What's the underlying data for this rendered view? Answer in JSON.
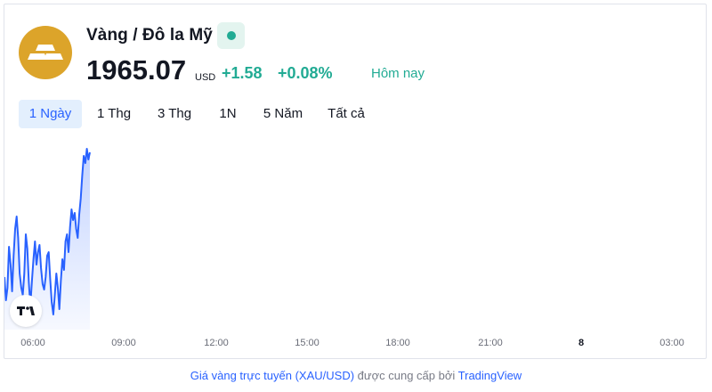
{
  "instrument": {
    "title": "Vàng / Đô la Mỹ",
    "logo_icon": "gold-bars-icon",
    "status_icon": "market-open-dot-icon",
    "status_color": "#22ab94"
  },
  "quote": {
    "price": "1965.07",
    "currency": "USD",
    "change": "+1.58",
    "change_pct": "+0.08%",
    "period": "Hôm nay",
    "positive_color": "#22ab94"
  },
  "tabs": [
    {
      "label": "1 Ngày",
      "active": true
    },
    {
      "label": "1 Thg",
      "active": false
    },
    {
      "label": "3 Thg",
      "active": false
    },
    {
      "label": "1N",
      "active": false
    },
    {
      "label": "5 Năm",
      "active": false
    },
    {
      "label": "Tất cả",
      "active": false
    }
  ],
  "chart_data": {
    "type": "area",
    "line_color": "#2962ff",
    "x_ticks": [
      "06:00",
      "09:00",
      "12:00",
      "15:00",
      "18:00",
      "21:00",
      "8",
      "03:00"
    ],
    "bold_ticks": [
      "8"
    ],
    "values": [
      0.28,
      0.15,
      0.22,
      0.45,
      0.35,
      0.2,
      0.4,
      0.55,
      0.62,
      0.5,
      0.3,
      0.22,
      0.18,
      0.3,
      0.52,
      0.44,
      0.25,
      0.12,
      0.26,
      0.38,
      0.48,
      0.35,
      0.42,
      0.46,
      0.33,
      0.24,
      0.21,
      0.28,
      0.4,
      0.42,
      0.27,
      0.14,
      0.07,
      0.18,
      0.3,
      0.22,
      0.1,
      0.26,
      0.38,
      0.32,
      0.48,
      0.52,
      0.42,
      0.56,
      0.66,
      0.6,
      0.64,
      0.55,
      0.5,
      0.63,
      0.72,
      0.85,
      0.96,
      0.92,
      1.0,
      0.94,
      0.98
    ]
  },
  "watermark": {
    "icon": "tradingview-logo-icon"
  },
  "footer": {
    "link_text": "Giá vàng trực tuyến (XAU/USD)",
    "plain_text": "được cung cấp bởi",
    "brand_text": "TradingView"
  }
}
